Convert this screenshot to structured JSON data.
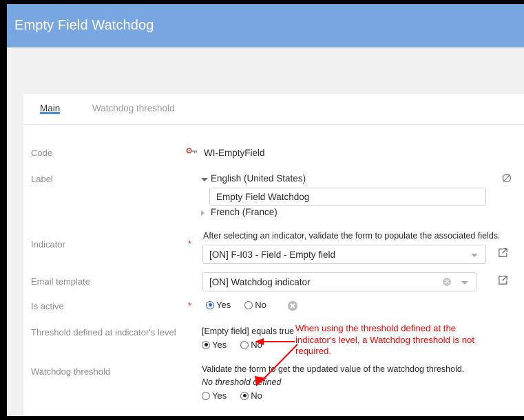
{
  "window": {
    "title": "Empty Field Watchdog"
  },
  "tabs": [
    {
      "label": "Main",
      "active": true
    },
    {
      "label": "Watchdog threshold",
      "active": false
    }
  ],
  "form": {
    "code": {
      "label": "Code",
      "icon": "key-icon",
      "value": "WI-EmptyField"
    },
    "label_field": {
      "label": "Label",
      "languages": [
        {
          "name": "English (United States)",
          "expanded": true
        },
        {
          "name": "French (France)",
          "expanded": false
        }
      ],
      "value": "Empty Field Watchdog",
      "clear_icon": "empty-set-icon"
    },
    "indicator": {
      "label": "Indicator",
      "required": "*",
      "hint": "After selecting an indicator, validate the form to populate the associated fields.",
      "value": "[ON] F-I03 - Field - Empty field",
      "open_icon": "external-link-icon"
    },
    "email_template": {
      "label": "Email template",
      "value": "[ON] Watchdog indicator",
      "clear_icon": "clear-icon",
      "open_icon": "external-link-icon"
    },
    "is_active": {
      "label": "Is active",
      "required": "*",
      "options": [
        {
          "label": "Yes",
          "checked": true
        },
        {
          "label": "No",
          "checked": false
        }
      ],
      "clear_icon": "clear-icon"
    },
    "threshold_indicator_level": {
      "label": "Threshold defined at indicator's level",
      "condition": "[Empty field] equals true",
      "options": [
        {
          "label": "Yes",
          "checked": true
        },
        {
          "label": "No",
          "checked": false
        }
      ]
    },
    "watchdog_threshold": {
      "label": "Watchdog threshold",
      "hint": "Validate the form to get the updated value of the watchdog threshold.",
      "status": "No threshold defined",
      "options": [
        {
          "label": "Yes",
          "checked": false
        },
        {
          "label": "No",
          "checked": true
        }
      ]
    }
  },
  "annotation": {
    "text": "When using the threshold defined at the indicator's level, a Watchdog threshold is not required.",
    "color": "#ff0000"
  },
  "colors": {
    "titlebar": "#78a6e0",
    "accent": "#4a8fd8",
    "required": "#e8262d",
    "label": "#8a8a8a",
    "page_background": "#f1f1f1",
    "frame": "#000000"
  }
}
